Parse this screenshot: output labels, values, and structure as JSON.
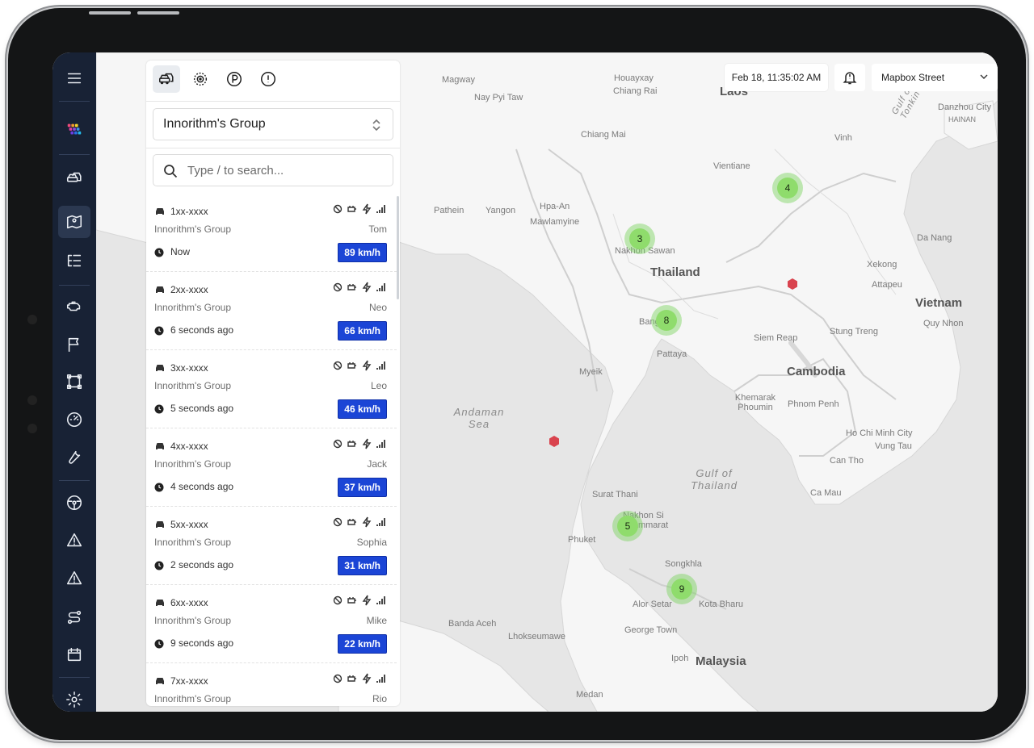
{
  "map": {
    "timestamp": "Feb 18, 11:35:02 AM",
    "style_select": "Mapbox Street",
    "labels": [
      {
        "text": "Magway",
        "kind": "city"
      },
      {
        "text": "Houayxay",
        "kind": "city"
      },
      {
        "text": "Chiang Rai",
        "kind": "city"
      },
      {
        "text": "Nay Pyi Taw",
        "kind": "city"
      },
      {
        "text": "Laos",
        "kind": "country"
      },
      {
        "text": "Danzhou City",
        "kind": "city"
      },
      {
        "text": "HAINAN",
        "kind": "city"
      },
      {
        "text": "Chiang Mai",
        "kind": "city"
      },
      {
        "text": "Vinh",
        "kind": "city"
      },
      {
        "text": "Vientiane",
        "kind": "city"
      },
      {
        "text": "Pathein",
        "kind": "city"
      },
      {
        "text": "Yangon",
        "kind": "city"
      },
      {
        "text": "Hpa-An",
        "kind": "city"
      },
      {
        "text": "Mawlamyine",
        "kind": "city"
      },
      {
        "text": "Nakhon Sawan",
        "kind": "city"
      },
      {
        "text": "Thailand",
        "kind": "country"
      },
      {
        "text": "Da Nang",
        "kind": "city"
      },
      {
        "text": "Xekong",
        "kind": "city"
      },
      {
        "text": "Attapeu",
        "kind": "city"
      },
      {
        "text": "Vietnam",
        "kind": "country"
      },
      {
        "text": "Quy Nhon",
        "kind": "city"
      },
      {
        "text": "Bangkok",
        "kind": "city"
      },
      {
        "text": "Siem Reap",
        "kind": "city"
      },
      {
        "text": "Stung Treng",
        "kind": "city"
      },
      {
        "text": "Pattaya",
        "kind": "city"
      },
      {
        "text": "Cambodia",
        "kind": "country"
      },
      {
        "text": "Myeik",
        "kind": "city"
      },
      {
        "text": "Khemarak Phoumin",
        "kind": "city"
      },
      {
        "text": "Phnom Penh",
        "kind": "city"
      },
      {
        "text": "Andaman Sea",
        "kind": "sea"
      },
      {
        "text": "Ho Chi Minh City",
        "kind": "city"
      },
      {
        "text": "Vung Tau",
        "kind": "city"
      },
      {
        "text": "Can Tho",
        "kind": "city"
      },
      {
        "text": "Gulf of Thailand",
        "kind": "sea"
      },
      {
        "text": "Surat Thani",
        "kind": "city"
      },
      {
        "text": "Ca Mau",
        "kind": "city"
      },
      {
        "text": "Nakhon Si Thammarat",
        "kind": "city"
      },
      {
        "text": "Phuket",
        "kind": "city"
      },
      {
        "text": "Songkhla",
        "kind": "city"
      },
      {
        "text": "Alor Setar",
        "kind": "city"
      },
      {
        "text": "Kota Bharu",
        "kind": "city"
      },
      {
        "text": "Banda Aceh",
        "kind": "city"
      },
      {
        "text": "Lhokseumawe",
        "kind": "city"
      },
      {
        "text": "George Town",
        "kind": "city"
      },
      {
        "text": "Ipoh",
        "kind": "city"
      },
      {
        "text": "Malaysia",
        "kind": "country"
      },
      {
        "text": "Medan",
        "kind": "city"
      },
      {
        "text": "Gulf of Tonkin",
        "kind": "sea"
      }
    ],
    "clusters": [
      {
        "count": "4"
      },
      {
        "count": "3"
      },
      {
        "count": "8"
      },
      {
        "count": "5"
      },
      {
        "count": "9"
      }
    ],
    "alert_markers": 2
  },
  "panel": {
    "tabs": [
      {
        "name": "vehicles-tab",
        "icon": "cars-icon"
      },
      {
        "name": "geofence-tab",
        "icon": "target-icon"
      },
      {
        "name": "parking-tab",
        "icon": "parking-icon"
      },
      {
        "name": "alerts-tab",
        "icon": "alert-icon"
      }
    ],
    "group_select": "Innorithm's Group",
    "search_placeholder": "Type / to search...",
    "vehicles": [
      {
        "plate": "1xx-xxxx",
        "group": "Innorithm's Group",
        "driver": "Tom",
        "time": "Now",
        "speed": "89 km/h"
      },
      {
        "plate": "2xx-xxxx",
        "group": "Innorithm's Group",
        "driver": "Neo",
        "time": "6 seconds ago",
        "speed": "66 km/h"
      },
      {
        "plate": "3xx-xxxx",
        "group": "Innorithm's Group",
        "driver": "Leo",
        "time": "5 seconds ago",
        "speed": "46 km/h"
      },
      {
        "plate": "4xx-xxxx",
        "group": "Innorithm's Group",
        "driver": "Jack",
        "time": "4 seconds ago",
        "speed": "37 km/h"
      },
      {
        "plate": "5xx-xxxx",
        "group": "Innorithm's Group",
        "driver": "Sophia",
        "time": "2 seconds ago",
        "speed": "31 km/h"
      },
      {
        "plate": "6xx-xxxx",
        "group": "Innorithm's Group",
        "driver": "Mike",
        "time": "9 seconds ago",
        "speed": "22 km/h"
      },
      {
        "plate": "7xx-xxxx",
        "group": "Innorithm's Group",
        "driver": "Rio",
        "time": "",
        "speed": ""
      }
    ]
  },
  "rail": {
    "items": [
      {
        "name": "menu-icon"
      },
      {
        "name": "app-logo-icon"
      },
      {
        "name": "vehicles-icon"
      },
      {
        "name": "map-icon"
      },
      {
        "name": "list-tree-icon"
      },
      {
        "name": "engine-icon"
      },
      {
        "name": "flag-icon"
      },
      {
        "name": "geofence-icon"
      },
      {
        "name": "speedometer-icon"
      },
      {
        "name": "wrench-icon"
      },
      {
        "name": "steering-wheel-icon"
      },
      {
        "name": "road-warning-icon"
      },
      {
        "name": "warning-icon"
      },
      {
        "name": "route-icon"
      },
      {
        "name": "calendar-icon"
      },
      {
        "name": "settings-icon"
      }
    ]
  },
  "colors": {
    "rail_bg": "#182235",
    "speed_badge": "#1b45d6",
    "cluster": "#8fdc6c",
    "alert_marker": "#d9434e"
  }
}
